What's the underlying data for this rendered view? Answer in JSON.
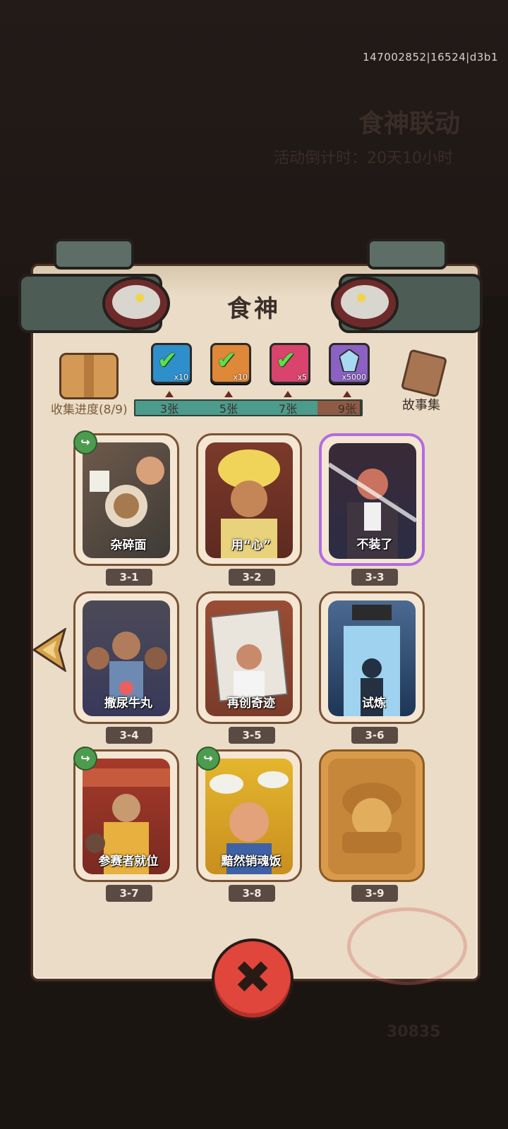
{
  "header": {
    "build_id": "147002852|16524|d3b1",
    "background_title": "食神联动",
    "background_subtitle": "活动倒计时：20天10小时"
  },
  "dialog": {
    "title": "食神",
    "collection_progress": "收集进度(8/9)",
    "story_label": "故事集",
    "progress": {
      "collected": 8,
      "total": 9,
      "milestones": [
        {
          "label": "3张",
          "reward_count": "x10",
          "color": "#2f8fca",
          "claimed": true
        },
        {
          "label": "5张",
          "reward_count": "x10",
          "color": "#e0883a",
          "claimed": true
        },
        {
          "label": "7张",
          "reward_count": "x5",
          "color": "#d8446e",
          "claimed": true
        },
        {
          "label": "9张",
          "reward_count": "x5000",
          "color": "#8b61c4",
          "claimed": false
        }
      ]
    },
    "cards": [
      {
        "id": "3-1",
        "name": "杂碎面",
        "shareable": true,
        "rarity": "normal"
      },
      {
        "id": "3-2",
        "name": "用“心”",
        "shareable": false,
        "rarity": "normal"
      },
      {
        "id": "3-3",
        "name": "不装了",
        "shareable": false,
        "rarity": "rare"
      },
      {
        "id": "3-4",
        "name": "撒尿牛丸",
        "shareable": false,
        "rarity": "normal"
      },
      {
        "id": "3-5",
        "name": "再创奇迹",
        "shareable": false,
        "rarity": "normal"
      },
      {
        "id": "3-6",
        "name": "试炼",
        "shareable": false,
        "rarity": "normal"
      },
      {
        "id": "3-7",
        "name": "参赛者就位",
        "shareable": true,
        "rarity": "normal"
      },
      {
        "id": "3-8",
        "name": "黯然销魂饭",
        "shareable": true,
        "rarity": "normal"
      },
      {
        "id": "3-9",
        "name": "",
        "shareable": false,
        "rarity": "locked"
      }
    ]
  },
  "background_score": "30835",
  "icons": {
    "close": "close-icon",
    "share": "share-icon",
    "prev": "chevron-left-icon"
  }
}
